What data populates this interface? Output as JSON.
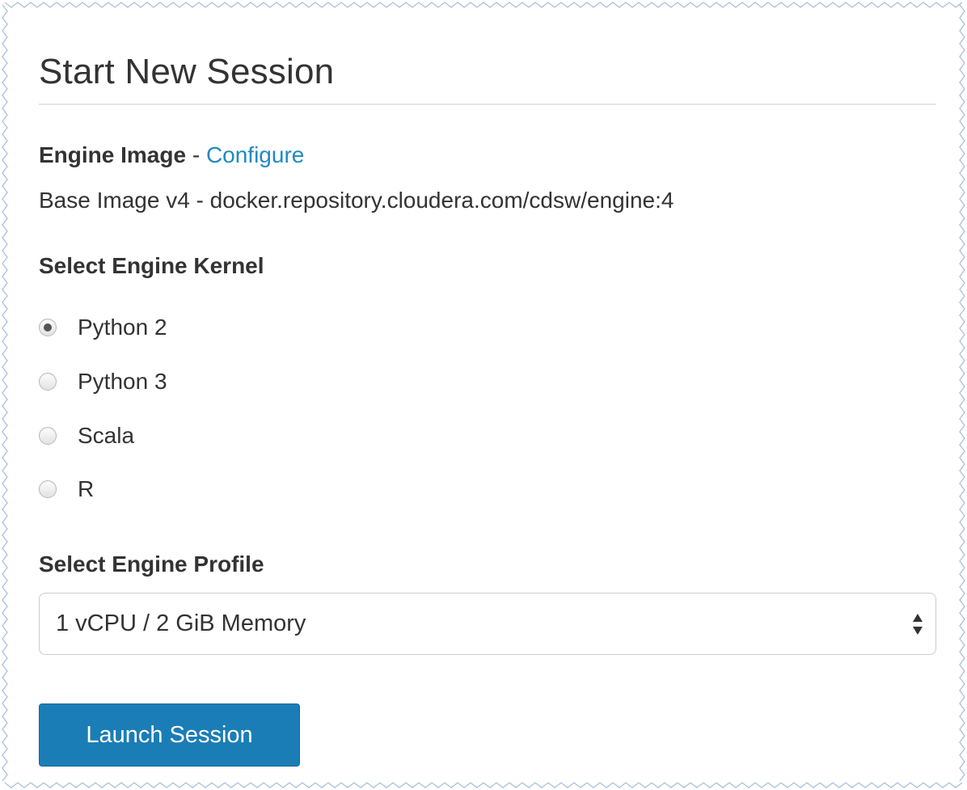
{
  "dialog": {
    "title": "Start New Session"
  },
  "engine_image": {
    "label": "Engine Image",
    "separator": " - ",
    "configure_link": "Configure",
    "value": "Base Image v4 - docker.repository.cloudera.com/cdsw/engine:4"
  },
  "kernel": {
    "heading": "Select Engine Kernel",
    "options": [
      {
        "label": "Python 2",
        "selected": true
      },
      {
        "label": "Python 3",
        "selected": false
      },
      {
        "label": "Scala",
        "selected": false
      },
      {
        "label": "R",
        "selected": false
      }
    ]
  },
  "profile": {
    "heading": "Select Engine Profile",
    "selected": "1 vCPU / 2 GiB Memory",
    "arrow_icon": "sort-arrows-icon"
  },
  "actions": {
    "launch_label": "Launch Session"
  },
  "colors": {
    "accent": "#1b7db6",
    "link": "#1f8ac0",
    "text": "#333333",
    "border_zigzag": "#a9c1dc"
  }
}
